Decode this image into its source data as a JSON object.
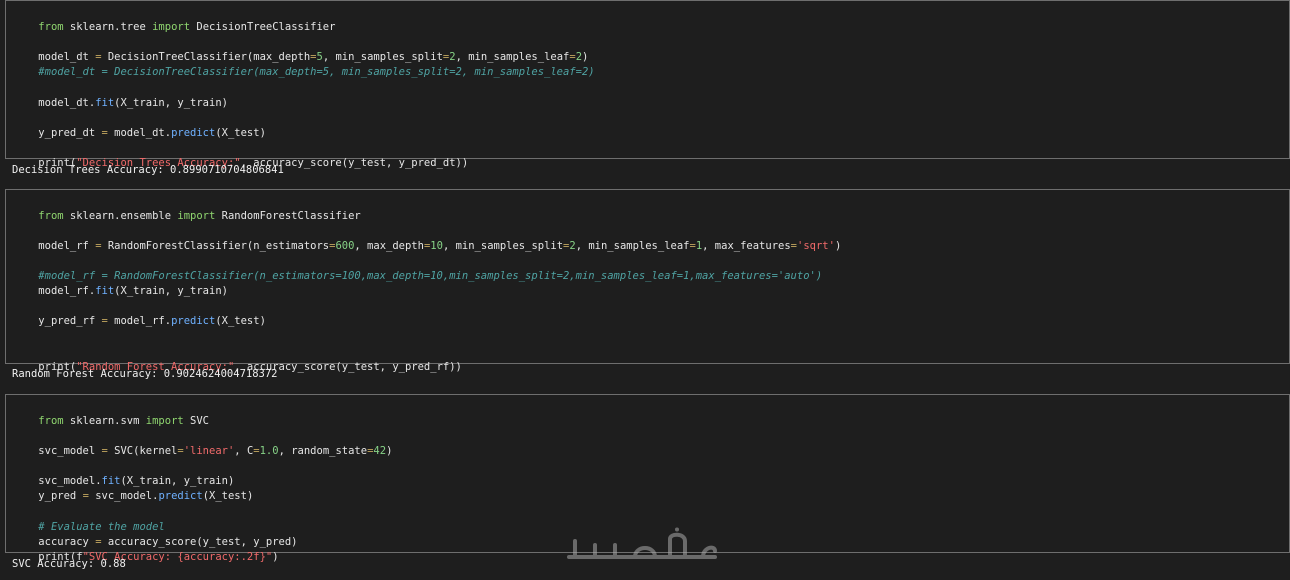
{
  "cells": [
    {
      "lines": [
        [
          "from",
          " sklearn.tree ",
          "import",
          " DecisionTreeClassifier"
        ],
        [
          "model_dt ",
          "=",
          " DecisionTreeClassifier(max_depth",
          "=",
          "5",
          ", min_samples_split",
          "=",
          "2",
          ", min_samples_leaf",
          "=",
          "2",
          ")"
        ],
        [
          "#model_dt = DecisionTreeClassifier(max_depth=5, min_samples_split=2, min_samples_leaf=2)"
        ],
        [
          "model_dt.",
          "fit",
          "(X_train, y_train)"
        ],
        [
          "y_pred_dt ",
          "=",
          " model_dt.",
          "predict",
          "(X_test)"
        ],
        [
          "print(",
          "\"Decision Trees Accuracy:\"",
          ", accuracy_score(y_test, y_pred_dt))"
        ]
      ],
      "output": "Decision Trees Accuracy: 0.8990710704806841"
    },
    {
      "lines": [
        [
          "from",
          " sklearn.ensemble ",
          "import",
          " RandomForestClassifier"
        ],
        [
          "model_rf ",
          "=",
          " RandomForestClassifier(n_estimators",
          "=",
          "600",
          ", max_depth",
          "=",
          "10",
          ", min_samples_split",
          "=",
          "2",
          ", min_samples_leaf",
          "=",
          "1",
          ", max_features",
          "=",
          "'sqrt'",
          ")"
        ],
        [
          "#model_rf = RandomForestClassifier(n_estimators=100,max_depth=10,min_samples_split=2,min_samples_leaf=1,max_features='auto')"
        ],
        [
          "model_rf.",
          "fit",
          "(X_train, y_train)"
        ],
        [
          "y_pred_rf ",
          "=",
          " model_rf.",
          "predict",
          "(X_test)"
        ],
        [
          "print(",
          "\"Random Forest Accuracy:\"",
          ", accuracy_score(y_test, y_pred_rf))"
        ]
      ],
      "output": "Random Forest Accuracy: 0.9024624004718372"
    },
    {
      "lines": [
        [
          "from",
          " sklearn.svm ",
          "import",
          " SVC"
        ],
        [
          "svc_model ",
          "=",
          " SVC(kernel",
          "=",
          "'linear'",
          ", C",
          "=",
          "1.0",
          ", random_state",
          "=",
          "42",
          ")"
        ],
        [
          "svc_model.",
          "fit",
          "(X_train, y_train)"
        ],
        [
          "y_pred ",
          "=",
          " svc_model.",
          "predict",
          "(X_test)"
        ],
        [
          "# Evaluate the model"
        ],
        [
          "accuracy ",
          "=",
          " accuracy_score(y_test, y_pred)"
        ],
        [
          "print(f",
          "\"SVC Accuracy: {accuracy:.2f}\"",
          ")"
        ]
      ],
      "output": "SVC Accuracy: 0.88"
    }
  ],
  "watermark": "خمسات"
}
